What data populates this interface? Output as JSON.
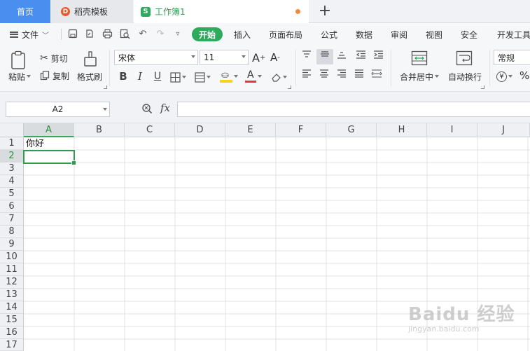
{
  "tabs": {
    "home": "首页",
    "template": "稻壳模板",
    "workbook": "工作簿1",
    "new_tab": "+"
  },
  "menu": {
    "file": "文件",
    "start": "开始",
    "items": [
      "插入",
      "页面布局",
      "公式",
      "数据",
      "审阅",
      "视图",
      "安全",
      "开发工具"
    ]
  },
  "ribbon": {
    "paste": "粘贴",
    "cut": "剪切",
    "copy": "复制",
    "format_painter": "格式刷",
    "font_name": "宋体",
    "font_size": "11",
    "merge_center": "合并居中",
    "wrap_text": "自动换行",
    "number_format": "常规",
    "bold": "B",
    "italic": "I",
    "underline": "U",
    "font_color_letter": "A",
    "grow": "A",
    "shrink": "A",
    "currency": "¥",
    "percent": "%"
  },
  "formula_bar": {
    "cell_ref": "A2",
    "fx": "fx",
    "content": ""
  },
  "sheet": {
    "columns": [
      "A",
      "B",
      "C",
      "D",
      "E",
      "F",
      "G",
      "H",
      "I",
      "J"
    ],
    "rows": [
      "1",
      "2",
      "3",
      "4",
      "5",
      "6",
      "7",
      "8",
      "9",
      "10",
      "11",
      "12",
      "13",
      "14",
      "15",
      "16",
      "17"
    ],
    "selected_column": "A",
    "selected_row": "2",
    "cells": {
      "A1": "你好"
    }
  },
  "watermark": {
    "main": "Baidu 经验",
    "sub": "jingyan.baidu.com"
  },
  "colors": {
    "accent_green": "#2eaa5c",
    "home_tab_blue": "#4a8ff0",
    "unsaved_dot": "#f08a3c"
  }
}
